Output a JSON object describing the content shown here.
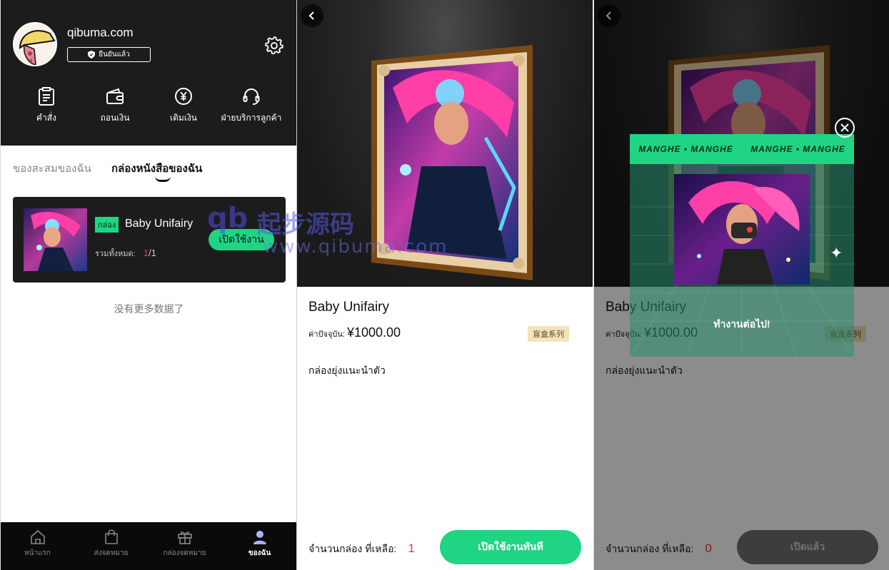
{
  "profile": {
    "site_name": "qibuma.com",
    "verified_label": "ยืนยันแล้ว"
  },
  "quick_actions": [
    {
      "label": "คำสั่ง",
      "icon": "clipboard-icon"
    },
    {
      "label": "ถอนเงิน",
      "icon": "wallet-icon"
    },
    {
      "label": "เติมเงิน",
      "icon": "yen-coin-icon"
    },
    {
      "label": "ฝ่ายบริการลูกค้า",
      "icon": "headset-icon"
    }
  ],
  "tabs": {
    "collection": "ของสะสมของฉัน",
    "boxes": "กล่องหนังสือของฉัน"
  },
  "box_card": {
    "badge": "กล่อง",
    "name": "Baby Unifairy",
    "total_label": "รวมทั้งหมด:",
    "remaining": "1",
    "total": "/1",
    "button": "เปิดใช้งาน"
  },
  "no_more": "没有更多数据了",
  "watermark": {
    "logo": "qb",
    "text": "起步源码",
    "url": "www.qibuma.com"
  },
  "bottom_nav": [
    {
      "label": "หน้าแรก",
      "icon": "home-icon",
      "active": false
    },
    {
      "label": "ส่งจดหมาย",
      "icon": "shopping-bag-icon",
      "active": false
    },
    {
      "label": "กล่องจดหมาย",
      "icon": "gift-icon",
      "active": false
    },
    {
      "label": "ของฉัน",
      "icon": "user-icon",
      "active": true
    }
  ],
  "product": {
    "title": "Baby Unifairy",
    "price_label": "ค่าปัจจุบัน:",
    "price": "¥1000.00",
    "tag": "盲盒系列",
    "desc": "กล่องยุ่งแนะนำตัว"
  },
  "footer": {
    "remain_label": "จำนวนกล่อง ที่เหลือ:",
    "remain_count_before": "1",
    "remain_count_after": "0",
    "open_now": "เปิดใช้งานทันที",
    "opened": "เปิดแล้ว"
  },
  "popup": {
    "band_text": "MANGHE • MANGHE",
    "message": "ทำงานต่อไป!"
  },
  "colors": {
    "accent": "#1fd483",
    "dark": "#1c1c1c",
    "alert": "#e63c3c",
    "tag_bg": "#f4e2b8"
  }
}
